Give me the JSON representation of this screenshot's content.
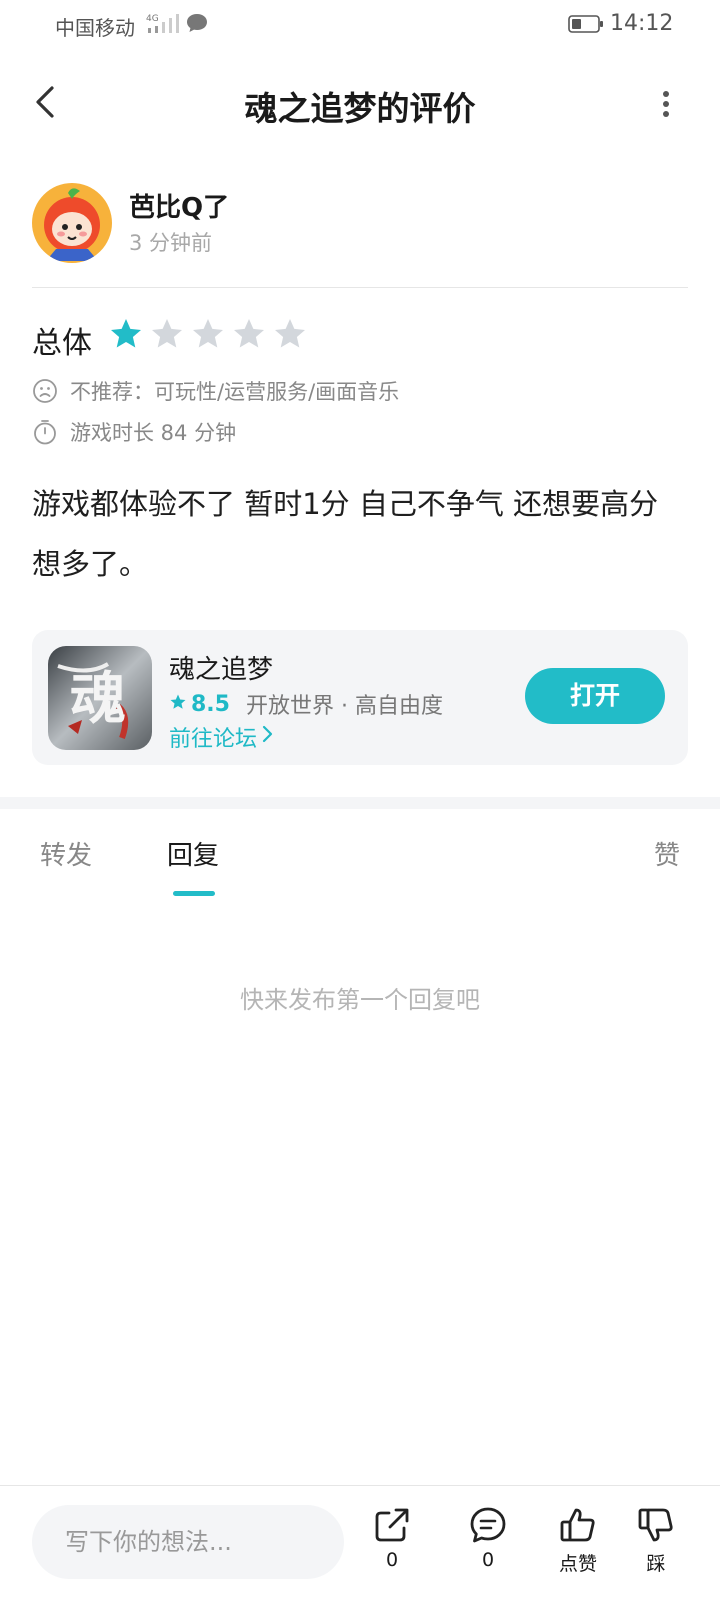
{
  "status_bar": {
    "carrier": "中国移动",
    "network": "4G",
    "time": "14:12",
    "icons": [
      "signal-icon",
      "message-icon",
      "battery-icon"
    ]
  },
  "nav": {
    "title": "魂之追梦的评价",
    "icons": [
      "back-icon",
      "more-icon"
    ]
  },
  "review": {
    "author": "芭比Q了",
    "time_ago": "3 分钟前",
    "rating_label": "总体",
    "rating": 1,
    "rating_max": 5,
    "not_recommend": "不推荐：可玩性/运营服务/画面音乐",
    "play_time": "游戏时长 84 分钟",
    "text": "游戏都体验不了 暂时1分 自己不争气 还想要高分 想多了。"
  },
  "game_card": {
    "name": "魂之追梦",
    "icon_char": "魂",
    "score": "8.5",
    "tags": "开放世界 · 高自由度",
    "forum_link": "前往论坛",
    "open_button": "打开"
  },
  "tabs": [
    {
      "label": "转发",
      "active": false
    },
    {
      "label": "回复",
      "active": true
    },
    {
      "label": "赞",
      "active": false
    }
  ],
  "empty_message": "快来发布第一个回复吧",
  "bottom_bar": {
    "input_placeholder": "写下你的想法...",
    "share_count": "0",
    "comment_count": "0",
    "like_label": "点赞",
    "dislike_label": "踩"
  },
  "colors": {
    "accent": "#22bcc8",
    "star_filled": "#22bcc8",
    "star_empty": "#d3d7dc",
    "card_bg": "#f4f5f7"
  }
}
